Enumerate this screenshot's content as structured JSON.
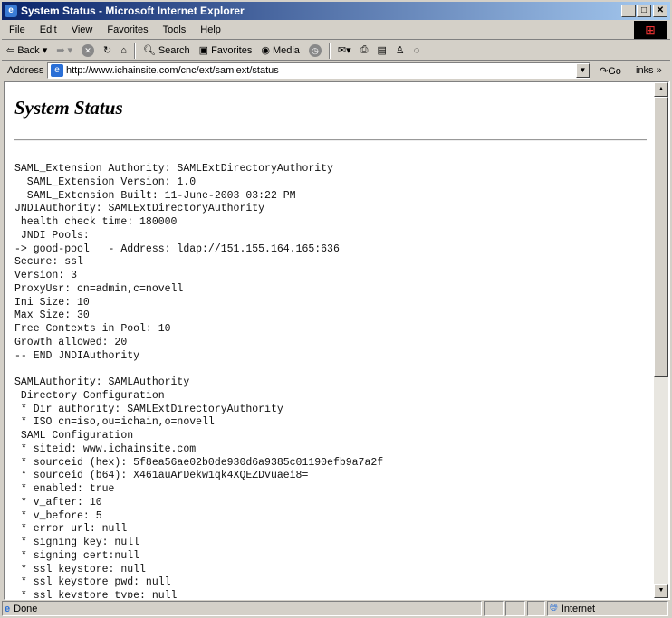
{
  "window": {
    "title": "System Status - Microsoft Internet Explorer"
  },
  "menu": [
    "File",
    "Edit",
    "View",
    "Favorites",
    "Tools",
    "Help"
  ],
  "toolbar": {
    "back": "Back",
    "search": "Search",
    "favorites": "Favorites",
    "media": "Media"
  },
  "address": {
    "label": "Address",
    "url": "http://www.ichainsite.com/cnc/ext/samlext/status",
    "go": "Go",
    "links": "inks"
  },
  "page": {
    "title": "System Status",
    "lines": [
      "SAML_Extension Authority: SAMLExtDirectoryAuthority",
      "  SAML_Extension Version: 1.0",
      "  SAML_Extension Built: 11-June-2003 03:22 PM",
      "JNDIAuthority: SAMLExtDirectoryAuthority",
      " health check time: 180000",
      " JNDI Pools:",
      "-> good-pool   - Address: ldap://151.155.164.165:636",
      "Secure: ssl",
      "Version: 3",
      "ProxyUsr: cn=admin,c=novell",
      "Ini Size: 10",
      "Max Size: 30",
      "Free Contexts in Pool: 10",
      "Growth allowed: 20",
      "-- END JNDIAuthority",
      "",
      "SAMLAuthority: SAMLAuthority",
      " Directory Configuration",
      " * Dir authority: SAMLExtDirectoryAuthority",
      " * ISO cn=iso,ou=ichain,o=novell",
      " SAML Configuration",
      " * siteid: www.ichainsite.com",
      " * sourceid (hex): 5f8ea56ae02b0de930d6a9385c01190efb9a7a2f",
      " * sourceid (b64): X461auArDekw1qk4XQEZDvuaei8=",
      " * enabled: true",
      " * v_after: 10",
      " * v_before: 5",
      " * error url: null",
      " * signing key: null",
      " * signing cert:null",
      " * ssl keystore: null",
      " * ssl keystore pwd: null",
      " * ssl keystore type: null"
    ]
  },
  "status": {
    "text": "Done",
    "zone": "Internet"
  }
}
